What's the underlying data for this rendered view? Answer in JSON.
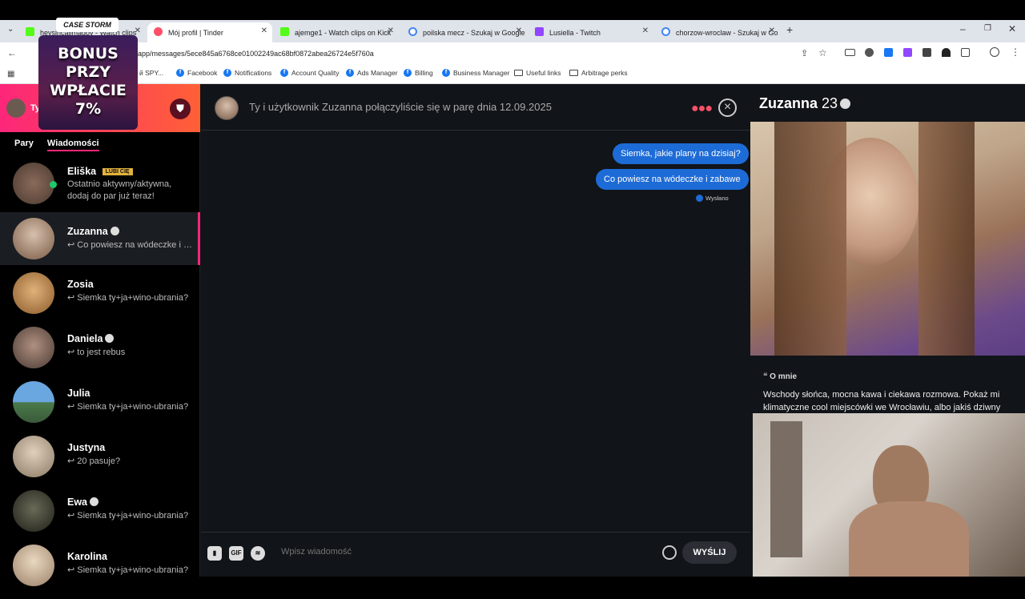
{
  "browser": {
    "tabs": [
      {
        "title": "heysiricallmadoy - Watch clips",
        "color": "#53fc18"
      },
      {
        "title": "Mój profil | Tinder",
        "color": "#fd5068"
      },
      {
        "title": "ajemge1 - Watch clips on Kick",
        "color": "#53fc18"
      },
      {
        "title": "poilska mecz - Szukaj w Google",
        "color": "#4285f4"
      },
      {
        "title": "Lusiella - Twitch",
        "color": "#9146ff"
      },
      {
        "title": "chorzow-wroclaw - Szukaj w Go",
        "color": "#4285f4"
      }
    ],
    "url": ".com/app/messages/5ece845a6768ce01002249ac68bf0872abea26724e5f760a",
    "bookmarks": [
      {
        "label": "й SPY...",
        "icon": "folder"
      },
      {
        "label": "Facebook",
        "icon": "fb"
      },
      {
        "label": "Notifications",
        "icon": "fb"
      },
      {
        "label": "Account Quality",
        "icon": "fb"
      },
      {
        "label": "Ads Manager",
        "icon": "fb"
      },
      {
        "label": "Billing",
        "icon": "fb"
      },
      {
        "label": "Business Manager",
        "icon": "fb"
      },
      {
        "label": "Useful links",
        "icon": "folder"
      },
      {
        "label": "Arbitrage perks",
        "icon": "folder"
      }
    ]
  },
  "overlay": {
    "logo": "CASE STORM",
    "line1": "BONUS",
    "line2": "PRZY",
    "line3": "WPŁACIE",
    "line4": "7%"
  },
  "left": {
    "header_user": "Ty",
    "tab_matches": "Pary",
    "tab_messages": "Wiadomości",
    "promo": {
      "name": "Eliška",
      "badge": "LUBI CIĘ",
      "text1": "Ostatnio aktywny/aktywna,",
      "text2": "dodaj do par już teraz!"
    },
    "conversations": [
      {
        "name": "Zuzanna",
        "verified": true,
        "preview": "↩ Co powiesz na wódeczke i zabawe",
        "color": "#c9b3a0"
      },
      {
        "name": "Zosia",
        "verified": false,
        "preview": "↩ Siemka ty+ja+wino-ubrania?",
        "color": "#d9a66b"
      },
      {
        "name": "Daniela",
        "verified": true,
        "preview": "↩ to jest rebus",
        "color": "#9a7a6a"
      },
      {
        "name": "Julia",
        "verified": false,
        "preview": "↩ Siemka ty+ja+wino-ubrania?",
        "color": "#6f9ac9"
      },
      {
        "name": "Justyna",
        "verified": false,
        "preview": "↩ 20 pasuje?",
        "color": "#c8b8a0"
      },
      {
        "name": "Ewa",
        "verified": true,
        "preview": "↩ Siemka ty+ja+wino-ubrania?",
        "color": "#4a4a3a"
      },
      {
        "name": "Karolina",
        "verified": false,
        "preview": "↩ Siemka ty+ja+wino-ubrania?",
        "color": "#d6c3a8"
      }
    ]
  },
  "chat": {
    "match_text": "Ty i użytkownik Zuzanna połączyliście się w parę dnia 12.09.2025",
    "messages": [
      "Siemka, jakie plany na dzisiaj?",
      "Co powiesz na wódeczke i zabawe"
    ],
    "status": "Wysłano",
    "input_placeholder": "Wpisz wiadomość",
    "gif_label": "GIF",
    "send_label": "WYŚLIJ"
  },
  "profile": {
    "name": "Zuzanna",
    "age": "23",
    "about_label": "O mnie",
    "bio": "Wschody słońca, mocna kawa i ciekawa rozmowa. Pokaż mi klimatyczne cool miejscówki we Wrocławiu, albo jakiś dziwny"
  }
}
